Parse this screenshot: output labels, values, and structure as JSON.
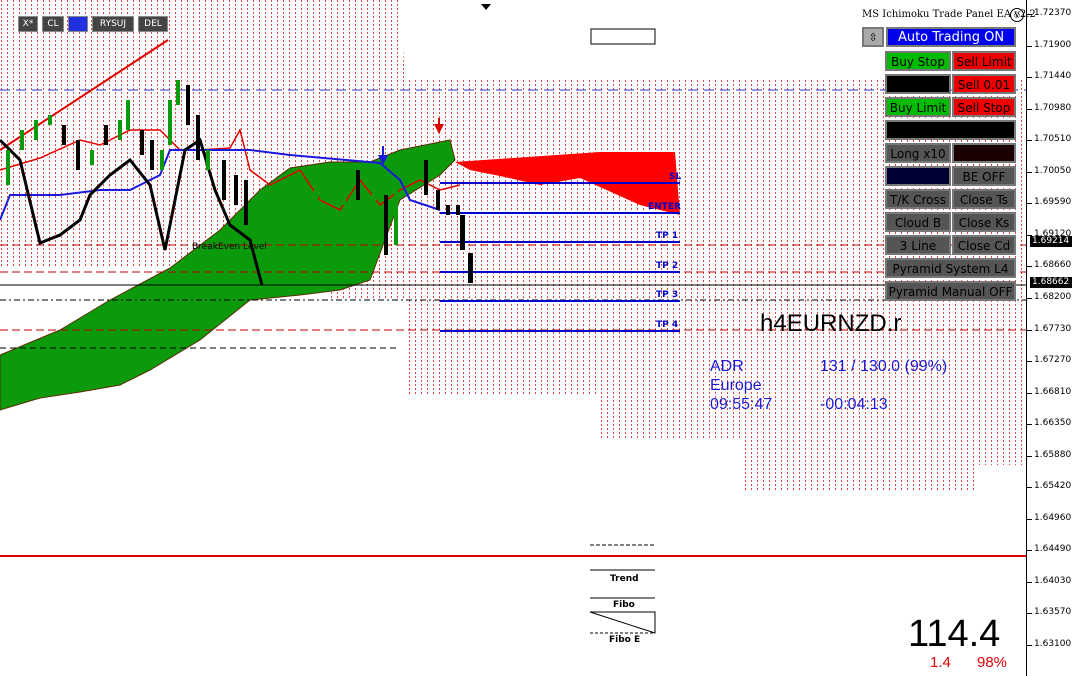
{
  "toolbar": {
    "buttons": [
      {
        "label": "X*",
        "color": "#444444"
      },
      {
        "label": "CL",
        "color": "#444444"
      },
      {
        "label": "",
        "color": "#1f2fe0"
      },
      {
        "label": "RYSUJ",
        "color": "#444444"
      },
      {
        "label": "DEL",
        "color": "#444444"
      }
    ]
  },
  "panel": {
    "title": "MS Ichimoku Trade Panel EA  v2.2",
    "smiley_icon": "smiley-icon",
    "arrow_icon": "up-down-arrow-icon",
    "auto_trading": "Auto Trading ON",
    "buy_stop": "Buy Stop",
    "sell_limit": "Sell Limit",
    "sell_lot": "Sell 0.01",
    "buy_limit": "Buy Limit",
    "sell_stop": "Sell Stop",
    "long_x10": "Long x10",
    "be_off": "BE OFF",
    "tk_cross": "T/K Cross",
    "close_ts": "Close Ts",
    "cloud_b": "Cloud B",
    "close_ks": "Close Ks",
    "three_line": "3 Line",
    "close_cd": "Close Cd",
    "pyramid_system": "Pyramid System  L4",
    "pyramid_manual": "Pyramid Manual OFF"
  },
  "levels": {
    "sl": "SL",
    "enter": "ENTER",
    "tp1": "TP 1",
    "tp2": "TP 2",
    "tp3": "TP 3",
    "tp4": "TP 4"
  },
  "chart_label": "BreakEven Level",
  "symbol": "h4EURNZD.r",
  "info": {
    "adr_label": "ADR",
    "adr_value": "131 / 130.0 (99%)",
    "session": "Europe",
    "time": "09:55:47",
    "countdown": "-00:04:13"
  },
  "stats": {
    "big": "114.4",
    "small_left": "1.4",
    "small_right": "98%"
  },
  "tools": {
    "trend": "Trend",
    "fibo": "Fibo",
    "fibo_e": "Fibo E"
  },
  "axis": {
    "prices": [
      "1.72370",
      "1.71900",
      "1.71440",
      "1.70980",
      "1.70510",
      "1.70050",
      "1.69590",
      "1.69120",
      "1.68660",
      "1.68200",
      "1.67730",
      "1.67270",
      "1.66810",
      "1.66350",
      "1.65880",
      "1.65420",
      "1.64960",
      "1.64490",
      "1.64030",
      "1.63570",
      "1.63100"
    ],
    "tag_high": "1.69214",
    "tag_low": "1.68662"
  }
}
